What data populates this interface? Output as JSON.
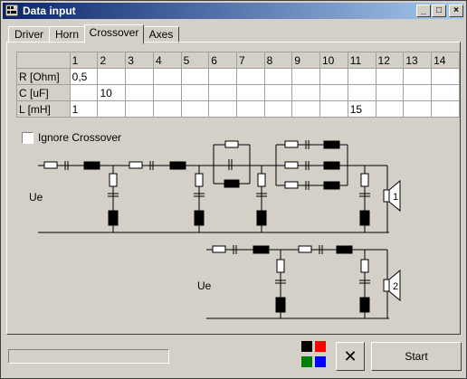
{
  "window": {
    "title": "Data input",
    "buttons": {
      "minimize": "_",
      "maximize": "□",
      "close": "×"
    }
  },
  "tabs": [
    {
      "label": "Driver",
      "active": false
    },
    {
      "label": "Horn",
      "active": false
    },
    {
      "label": "Crossover",
      "active": true
    },
    {
      "label": "Axes",
      "active": false
    }
  ],
  "grid": {
    "columns": [
      "1",
      "2",
      "3",
      "4",
      "5",
      "6",
      "7",
      "8",
      "9",
      "10",
      "11",
      "12",
      "13",
      "14"
    ],
    "rows": [
      {
        "label": "R [Ohm]",
        "cells": [
          "0,5",
          "",
          "",
          "",
          "",
          "",
          "",
          "",
          "",
          "",
          "",
          "",
          "",
          ""
        ]
      },
      {
        "label": "C [uF]",
        "cells": [
          "",
          "10",
          "",
          "",
          "",
          "",
          "",
          "",
          "",
          "",
          "",
          "",
          "",
          ""
        ]
      },
      {
        "label": "L [mH]",
        "cells": [
          "1",
          "",
          "",
          "",
          "",
          "",
          "",
          "",
          "",
          "",
          "15",
          "",
          "",
          ""
        ]
      }
    ]
  },
  "ignore_crossover": {
    "label": "Ignore Crossover",
    "checked": false
  },
  "circuit": {
    "top_input_label": "Ue",
    "bottom_input_label": "Ue",
    "driver1_label": "1",
    "driver2_label": "2"
  },
  "progress": {
    "value": 0
  },
  "color_swatches": {
    "colors": [
      "#000000",
      "#ff0000",
      "#008000",
      "#0000ff"
    ]
  },
  "buttons": {
    "cancel_icon": "scissors-icon",
    "start_label": "Start"
  }
}
